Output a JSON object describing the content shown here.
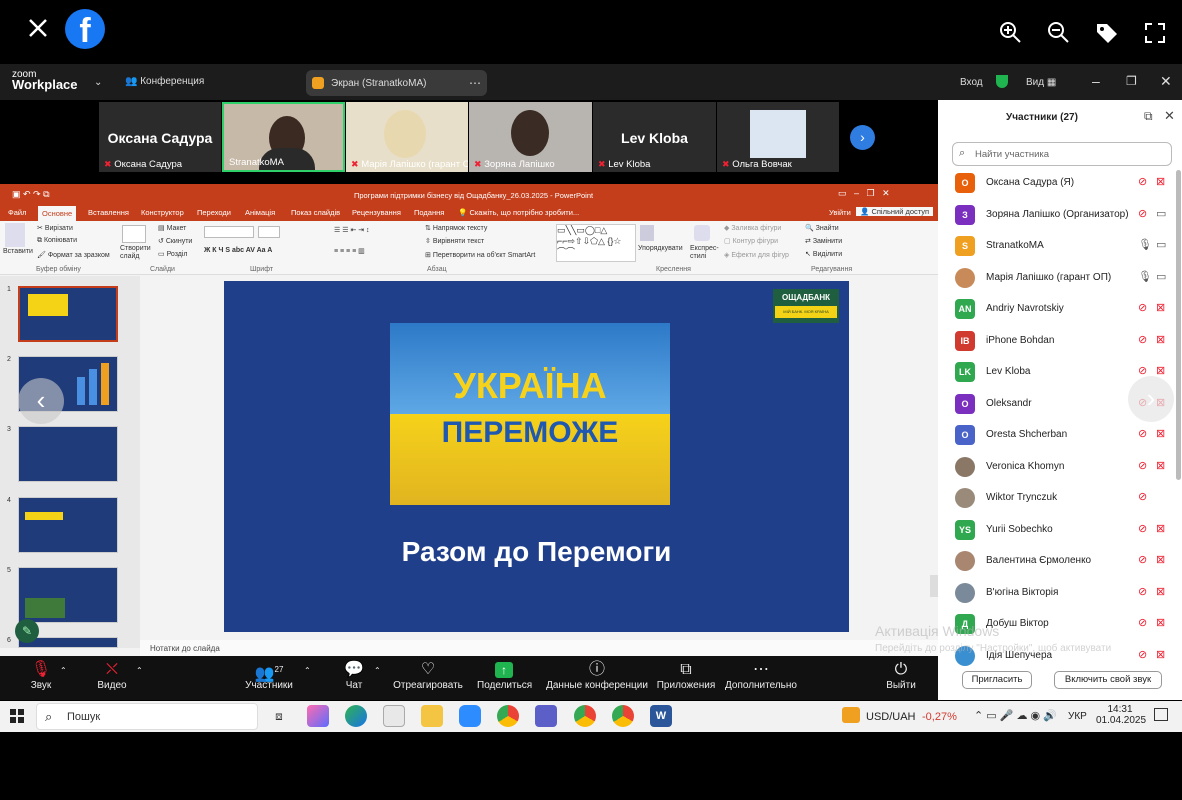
{
  "viewer": {
    "close_icon": "close-icon",
    "brand": "f"
  },
  "zoom": {
    "logo_line1": "zoom",
    "logo_line2": "Workplace",
    "conference_label": "Конференция",
    "share_label": "Экран (StranatkoMA)",
    "login_label": "Вход",
    "view_label": "Вид"
  },
  "videos": [
    {
      "name": "Оксана Садура",
      "big": "Оксана Садура"
    },
    {
      "name": "StranatkoMA"
    },
    {
      "name": "Марія Лапішко (гарант О..."
    },
    {
      "name": "Зоряна Лапішко"
    },
    {
      "name": "Lev Kloba",
      "big": "Lev Kloba"
    },
    {
      "name": "Ольга Вовчак"
    }
  ],
  "ppt": {
    "title": "Програми підтримки бізнесу від Ощадбанку_26.03.2025 - PowerPoint",
    "tabs": [
      "Файл",
      "Основне",
      "Вставлення",
      "Конструктор",
      "Переходи",
      "Анімація",
      "Показ слайдів",
      "Рецензування",
      "Подання"
    ],
    "tell_me": "Скажіть, що потрібно зробити...",
    "signin": "Увійти",
    "share": "Спільний доступ",
    "ribbon": {
      "cut": "Вирізати",
      "copy": "Копіювати",
      "format": "Формат за зразком",
      "paste": "Вставити",
      "clipboard": "Буфер обміну",
      "new_slide": "Створити слайд",
      "layout": "Макет",
      "reset": "Скинути",
      "section": "Розділ",
      "slides": "Слайди",
      "font": "Шрифт",
      "paragraph": "Абзац",
      "text_dir": "Напрямок тексту",
      "align_text": "Вирівняти текст",
      "smartart": "Перетворити на об'єкт SmartArt",
      "arrange": "Упорядкувати",
      "quick_styles": "Експрес-стилі",
      "fill": "Заливка фігури",
      "outline": "Контур фігури",
      "effects": "Ефекти для фігур",
      "drawing": "Креслення",
      "find": "Знайти",
      "replace": "Замінити",
      "select": "Виділити",
      "editing": "Редагування"
    },
    "slide_numbers": [
      "1",
      "2",
      "3",
      "4",
      "5",
      "6"
    ],
    "slide": {
      "brand": "ОЩАДБАНК",
      "brand_sub": "МІЙ БАНК. МОЯ КРАЇНА",
      "line1": "УКРАЇНА",
      "line2": "ПЕРЕМОЖЕ",
      "subtitle": "Разом до Перемоги"
    },
    "notes": "Нотатки до слайда"
  },
  "participants": {
    "title": "Участники (27)",
    "search_placeholder": "Найти участника",
    "items": [
      {
        "initial": "О",
        "name": "Оксана Садура (Я)",
        "color": "#e8610a"
      },
      {
        "initial": "З",
        "name": "Зоряна Лапішко (Организатор)",
        "color": "#7b2fbf"
      },
      {
        "initial": "S",
        "name": "StranatkoMA",
        "color": "#f0a020"
      },
      {
        "initial": "",
        "name": "Марія Лапішко (гарант ОП)",
        "color": "#c98a5a"
      },
      {
        "initial": "AN",
        "name": "Andriy Navrotskiy",
        "color": "#2fa84f"
      },
      {
        "initial": "IB",
        "name": "iPhone Bohdan",
        "color": "#d13a2f"
      },
      {
        "initial": "LK",
        "name": "Lev Kloba",
        "color": "#2fa84f"
      },
      {
        "initial": "O",
        "name": "Oleksandr",
        "color": "#7b2fbf"
      },
      {
        "initial": "O",
        "name": "Oresta Shcherban",
        "color": "#4a63c9"
      },
      {
        "initial": "",
        "name": "Veronica Khomyn",
        "color": "#8a7766"
      },
      {
        "initial": "",
        "name": "Wiktor Trynczuk",
        "color": "#9a8a7a"
      },
      {
        "initial": "YS",
        "name": "Yurii Sobechko",
        "color": "#2fa84f"
      },
      {
        "initial": "",
        "name": "Валентина Єрмоленко",
        "color": "#a88670"
      },
      {
        "initial": "",
        "name": "В'югіна Вікторія",
        "color": "#7a8a9a"
      },
      {
        "initial": "Д",
        "name": "Добуш Віктор",
        "color": "#2fa84f"
      },
      {
        "initial": "",
        "name": "Ідія Шепучера",
        "color": "#3a8fd0"
      }
    ],
    "invite": "Пригласить",
    "unmute": "Включить свой звук"
  },
  "toolbar": {
    "audio": "Звук",
    "video": "Видео",
    "participants": "Участники",
    "participants_count": "27",
    "chat": "Чат",
    "react": "Отреагировать",
    "share": "Поделиться",
    "info": "Данные конференции",
    "apps": "Приложения",
    "more": "Дополнительно",
    "leave": "Выйти"
  },
  "activation": {
    "title": "Активація Windows",
    "line": "Перейдіть до розділу \"Настройки\", щоб активувати Windows."
  },
  "taskbar": {
    "search": "Пошук",
    "currency": "USD/UAH",
    "change": "-0,27%",
    "lang": "УКР",
    "time": "14:31",
    "date": "01.04.2025"
  }
}
